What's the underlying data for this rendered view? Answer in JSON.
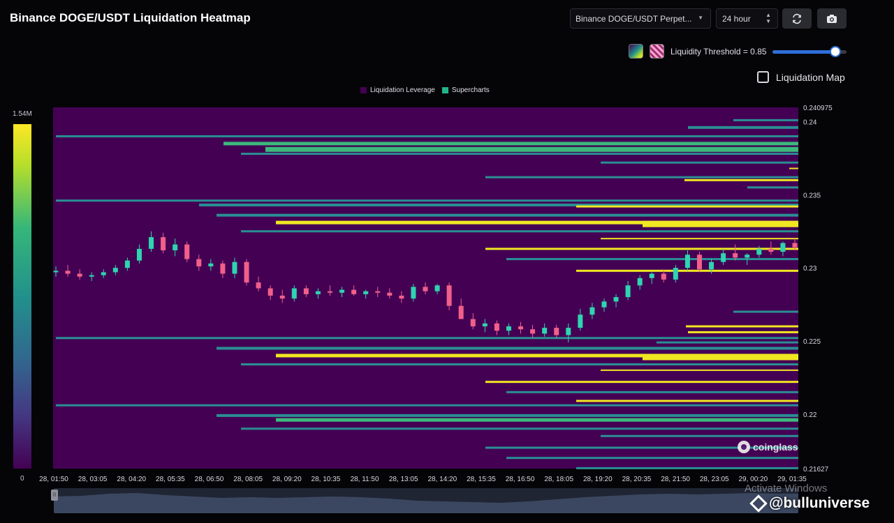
{
  "header": {
    "title": "Binance DOGE/USDT Liquidation Heatmap",
    "exchange_select": "Binance DOGE/USDT Perpet...",
    "range_select": "24 hour",
    "refresh_icon": "refresh-icon",
    "camera_icon": "camera-icon"
  },
  "controls": {
    "threshold_label": "Liquidity Threshold = 0.85",
    "threshold_value": 0.85,
    "liquidation_map_label": "Liquidation Map",
    "liquidation_map_checked": false,
    "color_schemes": [
      "viridis",
      "pink"
    ]
  },
  "legend": {
    "items": [
      {
        "label": "Liquidation Leverage",
        "color": "#440154"
      },
      {
        "label": "Supercharts",
        "color": "#21b58a"
      }
    ]
  },
  "colorbar": {
    "max_label": "1.54M",
    "min_label": "0"
  },
  "watermark": "coinglass",
  "overlay": {
    "activate_text": "Activate Windows",
    "credit": "@bulluniverse"
  },
  "colors": {
    "background": "#440154",
    "up": "#2fd4b0",
    "down": "#f0608a",
    "page": "#050508"
  },
  "chart_data": {
    "type": "heatmap",
    "title": "Binance DOGE/USDT Liquidation Heatmap",
    "ylim": [
      0.21627,
      0.240975
    ],
    "y_ticks": [
      0.240975,
      0.24,
      0.235,
      0.23,
      0.225,
      0.22,
      0.21627
    ],
    "x_ticks": [
      "28, 01:50",
      "28, 03:05",
      "28, 04:20",
      "28, 05:35",
      "28, 06:50",
      "28, 08:05",
      "28, 09:20",
      "28, 10:35",
      "28, 11:50",
      "28, 13:05",
      "28, 14:20",
      "28, 15:35",
      "28, 16:50",
      "28, 18:05",
      "28, 19:20",
      "28, 20:35",
      "28, 21:50",
      "28, 23:05",
      "29, 00:20",
      "29, 01:35"
    ],
    "candles": [
      [
        0.2297,
        0.2301,
        0.2294,
        0.2298
      ],
      [
        0.2298,
        0.2302,
        0.2294,
        0.2296
      ],
      [
        0.2296,
        0.2299,
        0.2292,
        0.2294
      ],
      [
        0.2294,
        0.2297,
        0.2291,
        0.2295
      ],
      [
        0.2295,
        0.2299,
        0.2293,
        0.2297
      ],
      [
        0.2297,
        0.2302,
        0.2295,
        0.23
      ],
      [
        0.23,
        0.2307,
        0.2298,
        0.2305
      ],
      [
        0.2305,
        0.2316,
        0.2303,
        0.2313
      ],
      [
        0.2313,
        0.2325,
        0.2311,
        0.2321
      ],
      [
        0.2321,
        0.2324,
        0.231,
        0.2312
      ],
      [
        0.2312,
        0.232,
        0.2308,
        0.2316
      ],
      [
        0.2316,
        0.2318,
        0.2304,
        0.2306
      ],
      [
        0.2306,
        0.2309,
        0.2298,
        0.2301
      ],
      [
        0.2301,
        0.2306,
        0.2298,
        0.2303
      ],
      [
        0.2303,
        0.2305,
        0.2293,
        0.2296
      ],
      [
        0.2296,
        0.2307,
        0.2293,
        0.2304
      ],
      [
        0.2304,
        0.2306,
        0.2288,
        0.229
      ],
      [
        0.229,
        0.2294,
        0.2284,
        0.2286
      ],
      [
        0.2286,
        0.2288,
        0.2278,
        0.2281
      ],
      [
        0.2281,
        0.2285,
        0.2276,
        0.2279
      ],
      [
        0.2279,
        0.2288,
        0.2277,
        0.2286
      ],
      [
        0.2286,
        0.2288,
        0.228,
        0.2282
      ],
      [
        0.2282,
        0.2286,
        0.2279,
        0.2284
      ],
      [
        0.2284,
        0.2288,
        0.2281,
        0.2283
      ],
      [
        0.2283,
        0.2287,
        0.228,
        0.2285
      ],
      [
        0.2285,
        0.2288,
        0.2281,
        0.2282
      ],
      [
        0.2282,
        0.2285,
        0.2279,
        0.2284
      ],
      [
        0.2284,
        0.2287,
        0.228,
        0.2283
      ],
      [
        0.2283,
        0.2286,
        0.2279,
        0.2281
      ],
      [
        0.2281,
        0.2284,
        0.2276,
        0.2279
      ],
      [
        0.2279,
        0.2289,
        0.2277,
        0.2287
      ],
      [
        0.2287,
        0.229,
        0.2282,
        0.2284
      ],
      [
        0.2284,
        0.2289,
        0.2282,
        0.2288
      ],
      [
        0.2288,
        0.229,
        0.2271,
        0.2274
      ],
      [
        0.2274,
        0.2279,
        0.2268,
        0.2265
      ],
      [
        0.2265,
        0.2269,
        0.2258,
        0.226
      ],
      [
        0.226,
        0.2265,
        0.2256,
        0.2262
      ],
      [
        0.2262,
        0.2264,
        0.2254,
        0.2257
      ],
      [
        0.2257,
        0.2262,
        0.2254,
        0.226
      ],
      [
        0.226,
        0.2263,
        0.2255,
        0.2258
      ],
      [
        0.2258,
        0.2261,
        0.2252,
        0.2255
      ],
      [
        0.2255,
        0.2262,
        0.2253,
        0.2259
      ],
      [
        0.2259,
        0.2261,
        0.2252,
        0.2254
      ],
      [
        0.2254,
        0.2262,
        0.2249,
        0.2259
      ],
      [
        0.2259,
        0.2272,
        0.2257,
        0.2268
      ],
      [
        0.2268,
        0.2276,
        0.2265,
        0.2273
      ],
      [
        0.2273,
        0.2279,
        0.227,
        0.2277
      ],
      [
        0.2277,
        0.2282,
        0.2273,
        0.228
      ],
      [
        0.228,
        0.2291,
        0.2278,
        0.2288
      ],
      [
        0.2288,
        0.2295,
        0.2285,
        0.2293
      ],
      [
        0.2293,
        0.2297,
        0.2289,
        0.2296
      ],
      [
        0.2296,
        0.2299,
        0.229,
        0.2292
      ],
      [
        0.2292,
        0.2302,
        0.229,
        0.23
      ],
      [
        0.23,
        0.2312,
        0.2298,
        0.2309
      ],
      [
        0.2309,
        0.2311,
        0.2297,
        0.2299
      ],
      [
        0.2299,
        0.2306,
        0.2296,
        0.2304
      ],
      [
        0.2304,
        0.2313,
        0.2302,
        0.231
      ],
      [
        0.231,
        0.2316,
        0.2305,
        0.2307
      ],
      [
        0.2307,
        0.231,
        0.2302,
        0.2309
      ],
      [
        0.2309,
        0.2315,
        0.2307,
        0.2313
      ],
      [
        0.2313,
        0.2318,
        0.2309,
        0.2311
      ],
      [
        0.2311,
        0.2318,
        0.2308,
        0.2317
      ],
      [
        0.2317,
        0.232,
        0.2312,
        0.2314
      ]
    ]
  }
}
